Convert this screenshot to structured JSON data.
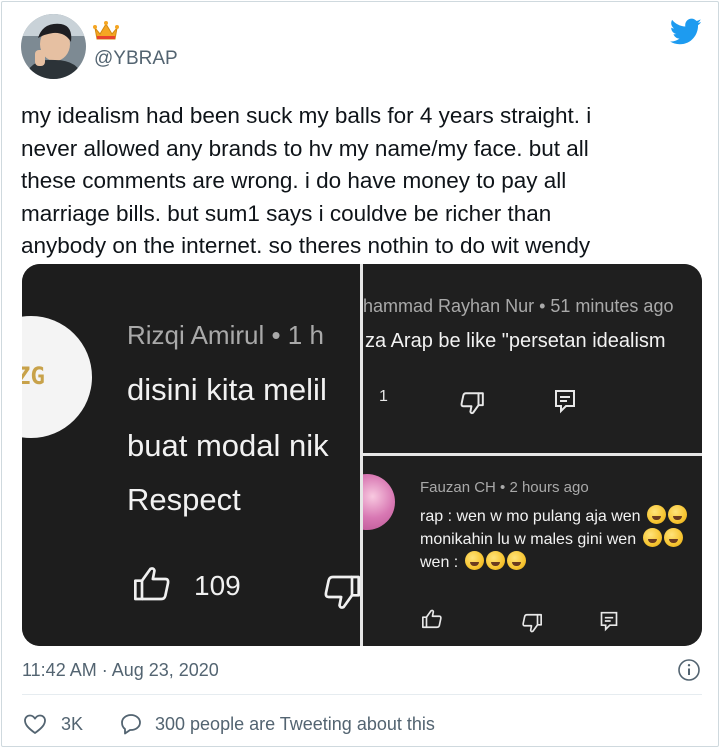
{
  "author": {
    "handle": "@YBRAP"
  },
  "tweet": {
    "lines": [
      "my idealism had been suck my balls for 4 years straight. i",
      "never allowed any brands to hv my name/my face. but all",
      "these comments are wrong. i do have money to pay all",
      "marriage bills. but sum1 says i couldve be richer than",
      "anybody on the internet. so theres nothin to do wit wendy"
    ],
    "timestamp": "11:42 AM · Aug 23, 2020",
    "likes": "3K",
    "replies_text": "300 people are Tweeting about this"
  },
  "media": {
    "left_comment": {
      "author": "Rizqi Amirul • 1 h",
      "lines": [
        "disini kita melil",
        "buat modal nik",
        "Respect"
      ],
      "like_count": "109",
      "logo_text": "ZG"
    },
    "top_right_comment": {
      "meta": "hammad Rayhan Nur • 51 minutes ago",
      "text": "za Arap be like \"persetan idealism",
      "like_count": "1"
    },
    "bottom_right_comment": {
      "meta": "Fauzan CH • 2 hours ago",
      "line1": "rap : wen w mo pulang aja wen",
      "line2": "monikahin lu w males gini wen",
      "line3": "wen :"
    }
  },
  "colors": {
    "twitter_blue": "#1d9bf0",
    "secondary_text": "#536471",
    "media_bg": "#1f1f1f"
  },
  "icons": [
    "crown-icon",
    "twitter-bird-icon",
    "thumbs-up-icon",
    "thumbs-down-icon",
    "reply-icon",
    "info-icon",
    "heart-icon",
    "speech-bubble-icon"
  ]
}
